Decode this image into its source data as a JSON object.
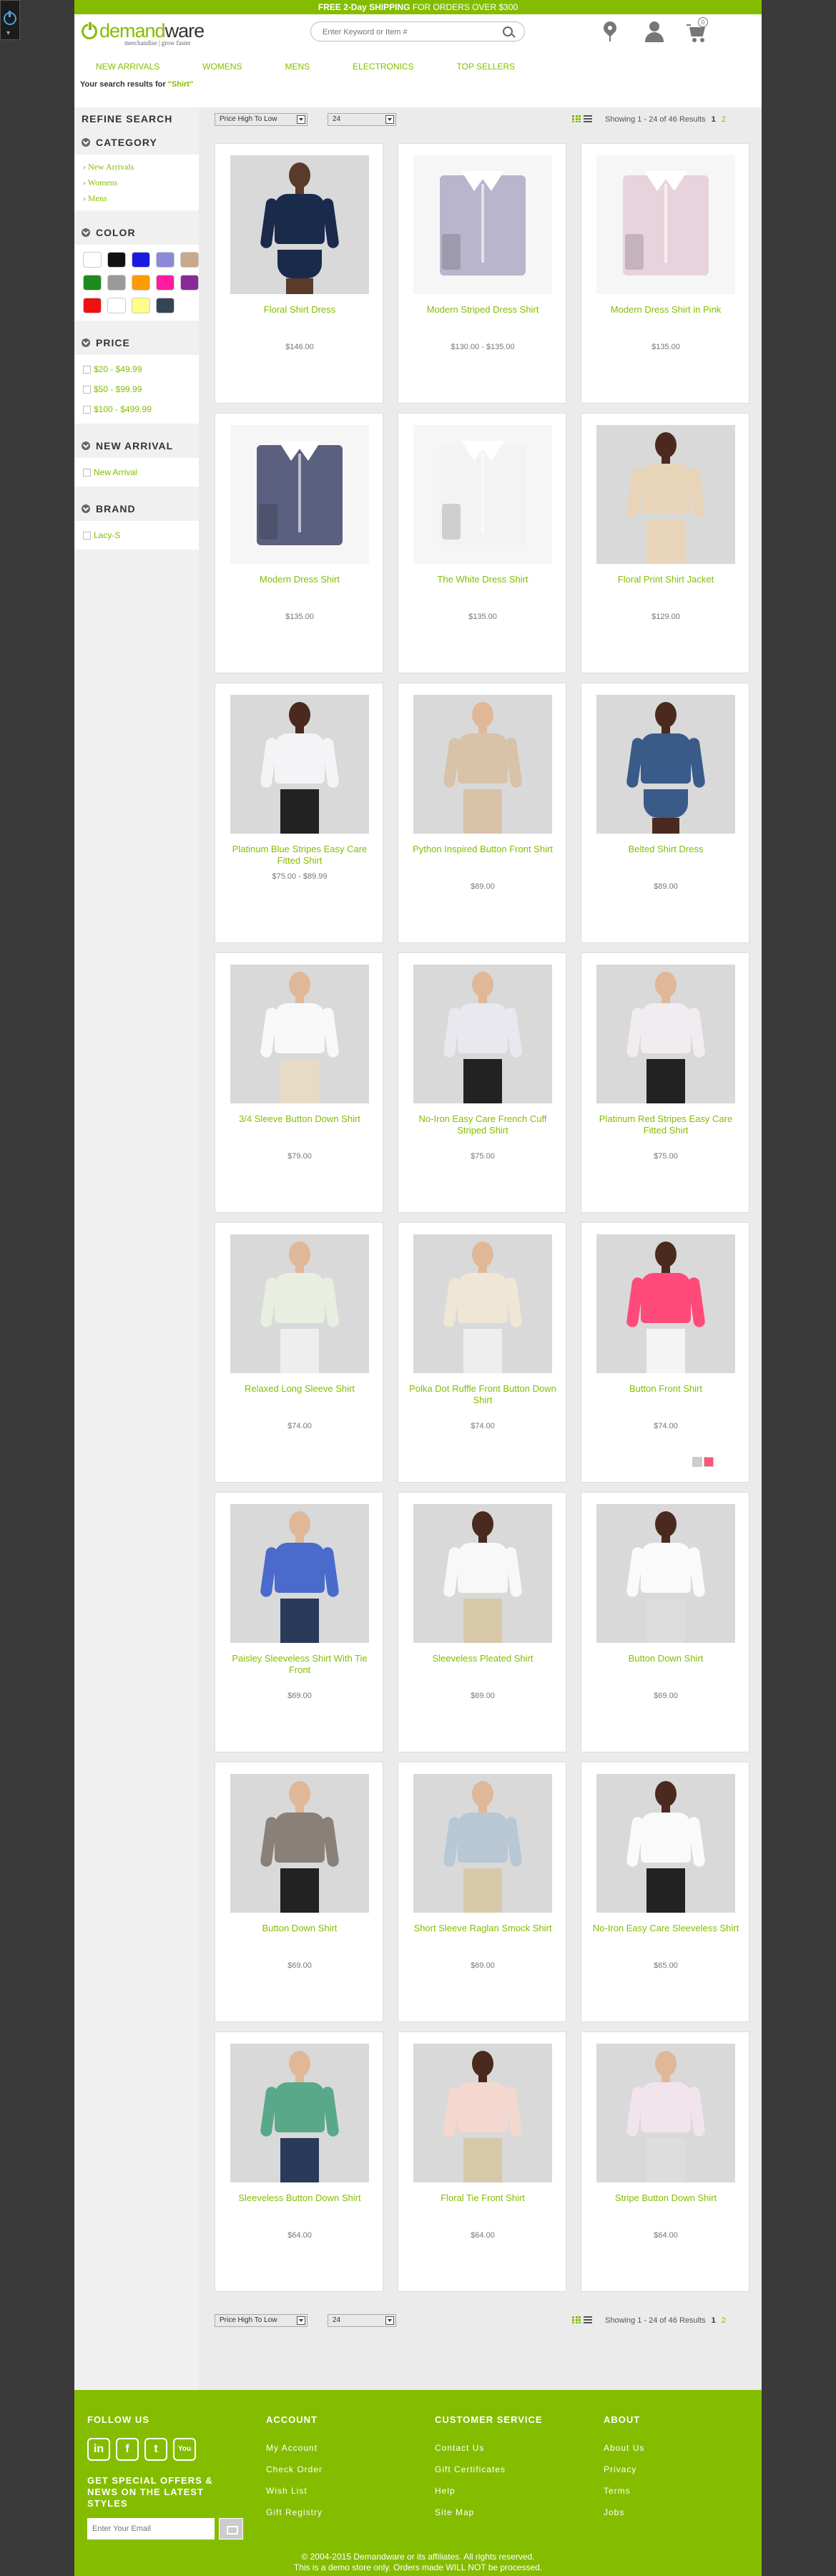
{
  "promo": {
    "bold": "FREE 2-Day SHIPPING",
    "rest": " FOR ORDERS OVER $300"
  },
  "logo": {
    "power_part": "demand",
    "rest": "ware",
    "tagline": "merchandise | grow faster"
  },
  "search": {
    "placeholder": "Enter Keyword or Item #"
  },
  "cart": {
    "count": "0"
  },
  "nav": [
    "NEW ARRIVALS",
    "WOMENS",
    "MENS",
    "ELECTRONICS",
    "TOP SELLERS"
  ],
  "results": {
    "prefix": "Your search results for ",
    "query": "\"Shirt\""
  },
  "refine": {
    "title": "REFINE SEARCH"
  },
  "facets": {
    "category": {
      "title": "CATEGORY",
      "items": [
        "New Arrivals",
        "Womens",
        "Mens"
      ]
    },
    "color": {
      "title": "COLOR",
      "swatches": [
        "#ffffff",
        "#111111",
        "#1a1adf",
        "#8a8ad6",
        "#c8a98c",
        "#1e8a1e",
        "#9a9a9a",
        "#ff9a00",
        "#ff1aa0",
        "#8a2a9a",
        "#ee1111",
        "#ffffff",
        "#ffff88",
        "#334455"
      ]
    },
    "price": {
      "title": "PRICE",
      "items": [
        "$20 - $49.99",
        "$50 - $99.99",
        "$100 - $499.99"
      ]
    },
    "new_arrival": {
      "title": "NEW ARRIVAL",
      "items": [
        "New Arrival"
      ]
    },
    "brand": {
      "title": "BRAND",
      "items": [
        "Lacy-S"
      ]
    }
  },
  "toolbar": {
    "sort": "Price High To Low",
    "per_page": "24",
    "showing": "Showing 1 - 24 of 46 Results",
    "page1": "1",
    "page2": "2"
  },
  "toolbar_bottom": {
    "sort": "Price High To Low",
    "per_page": "24",
    "showing": "Showing 1 - 24 of 46 Results",
    "page1": "1",
    "page2": "2"
  },
  "products": [
    {
      "name": "Floral Shirt Dress",
      "price": "$146.00"
    },
    {
      "name": "Modern Striped Dress Shirt",
      "price": "$130.00 - $135.00"
    },
    {
      "name": "Modern Dress Shirt in Pink",
      "price": "$135.00"
    },
    {
      "name": "Modern Dress Shirt",
      "price": "$135.00"
    },
    {
      "name": "The White Dress Shirt",
      "price": "$135.00"
    },
    {
      "name": "Floral Print Shirt Jacket",
      "price": "$129.00"
    },
    {
      "name": "Platinum Blue Stripes Easy Care Fitted Shirt",
      "price": "$75.00 - $89.99"
    },
    {
      "name": "Python Inspired Button Front Shirt",
      "price": "$89.00"
    },
    {
      "name": "Belted Shirt Dress",
      "price": "$89.00"
    },
    {
      "name": "3/4 Sleeve Button Down Shirt",
      "price": "$79.00"
    },
    {
      "name": "No-Iron Easy Care French Cuff Striped Shirt",
      "price": "$75.00"
    },
    {
      "name": "Platinum Red Stripes Easy Care Fitted Shirt",
      "price": "$75.00"
    },
    {
      "name": "Relaxed Long Sleeve Shirt",
      "price": "$74.00"
    },
    {
      "name": "Polka Dot Ruffle Front Button Down Shirt",
      "price": "$74.00"
    },
    {
      "name": "Button Front Shirt",
      "price": "$74.00"
    },
    {
      "name": "Paisley Sleeveless Shirt With Tie Front",
      "price": "$69.00"
    },
    {
      "name": "Sleeveless Pleated Shirt",
      "price": "$69.00"
    },
    {
      "name": "Button Down Shirt",
      "price": "$69.00"
    },
    {
      "name": "Button Down Shirt",
      "price": "$69.00"
    },
    {
      "name": "Short Sleeve Raglan Smock Shirt",
      "price": "$69.00"
    },
    {
      "name": "No-Iron Easy Care Sleeveless Shirt",
      "price": "$65.00"
    },
    {
      "name": "Sleeveless Button Down Shirt",
      "price": "$64.00"
    },
    {
      "name": "Floral Tie Front Shirt",
      "price": "$64.00"
    },
    {
      "name": "Stripe Button Down Shirt",
      "price": "$64.00"
    }
  ],
  "footer": {
    "follow": {
      "title": "FOLLOW US",
      "icons": [
        "in",
        "f",
        "t",
        "You"
      ]
    },
    "offers": "GET SPECIAL OFFERS & NEWS ON THE LATEST STYLES",
    "email_placeholder": "Enter Your Email",
    "account": {
      "title": "ACCOUNT",
      "links": [
        "My Account",
        "Check Order",
        "Wish List",
        "Gift Registry"
      ]
    },
    "customer_service": {
      "title": "CUSTOMER SERVICE",
      "links": [
        "Contact Us",
        "Gift Certificates",
        "Help",
        "Site Map"
      ]
    },
    "about": {
      "title": "ABOUT",
      "links": [
        "About Us",
        "Privacy",
        "Terms",
        "Jobs"
      ]
    },
    "copyright": "© 2004-2015 Demandware or its affiliates. All rights reserved.",
    "demo_note": "This is a demo store only. Orders made WILL NOT be processed."
  }
}
